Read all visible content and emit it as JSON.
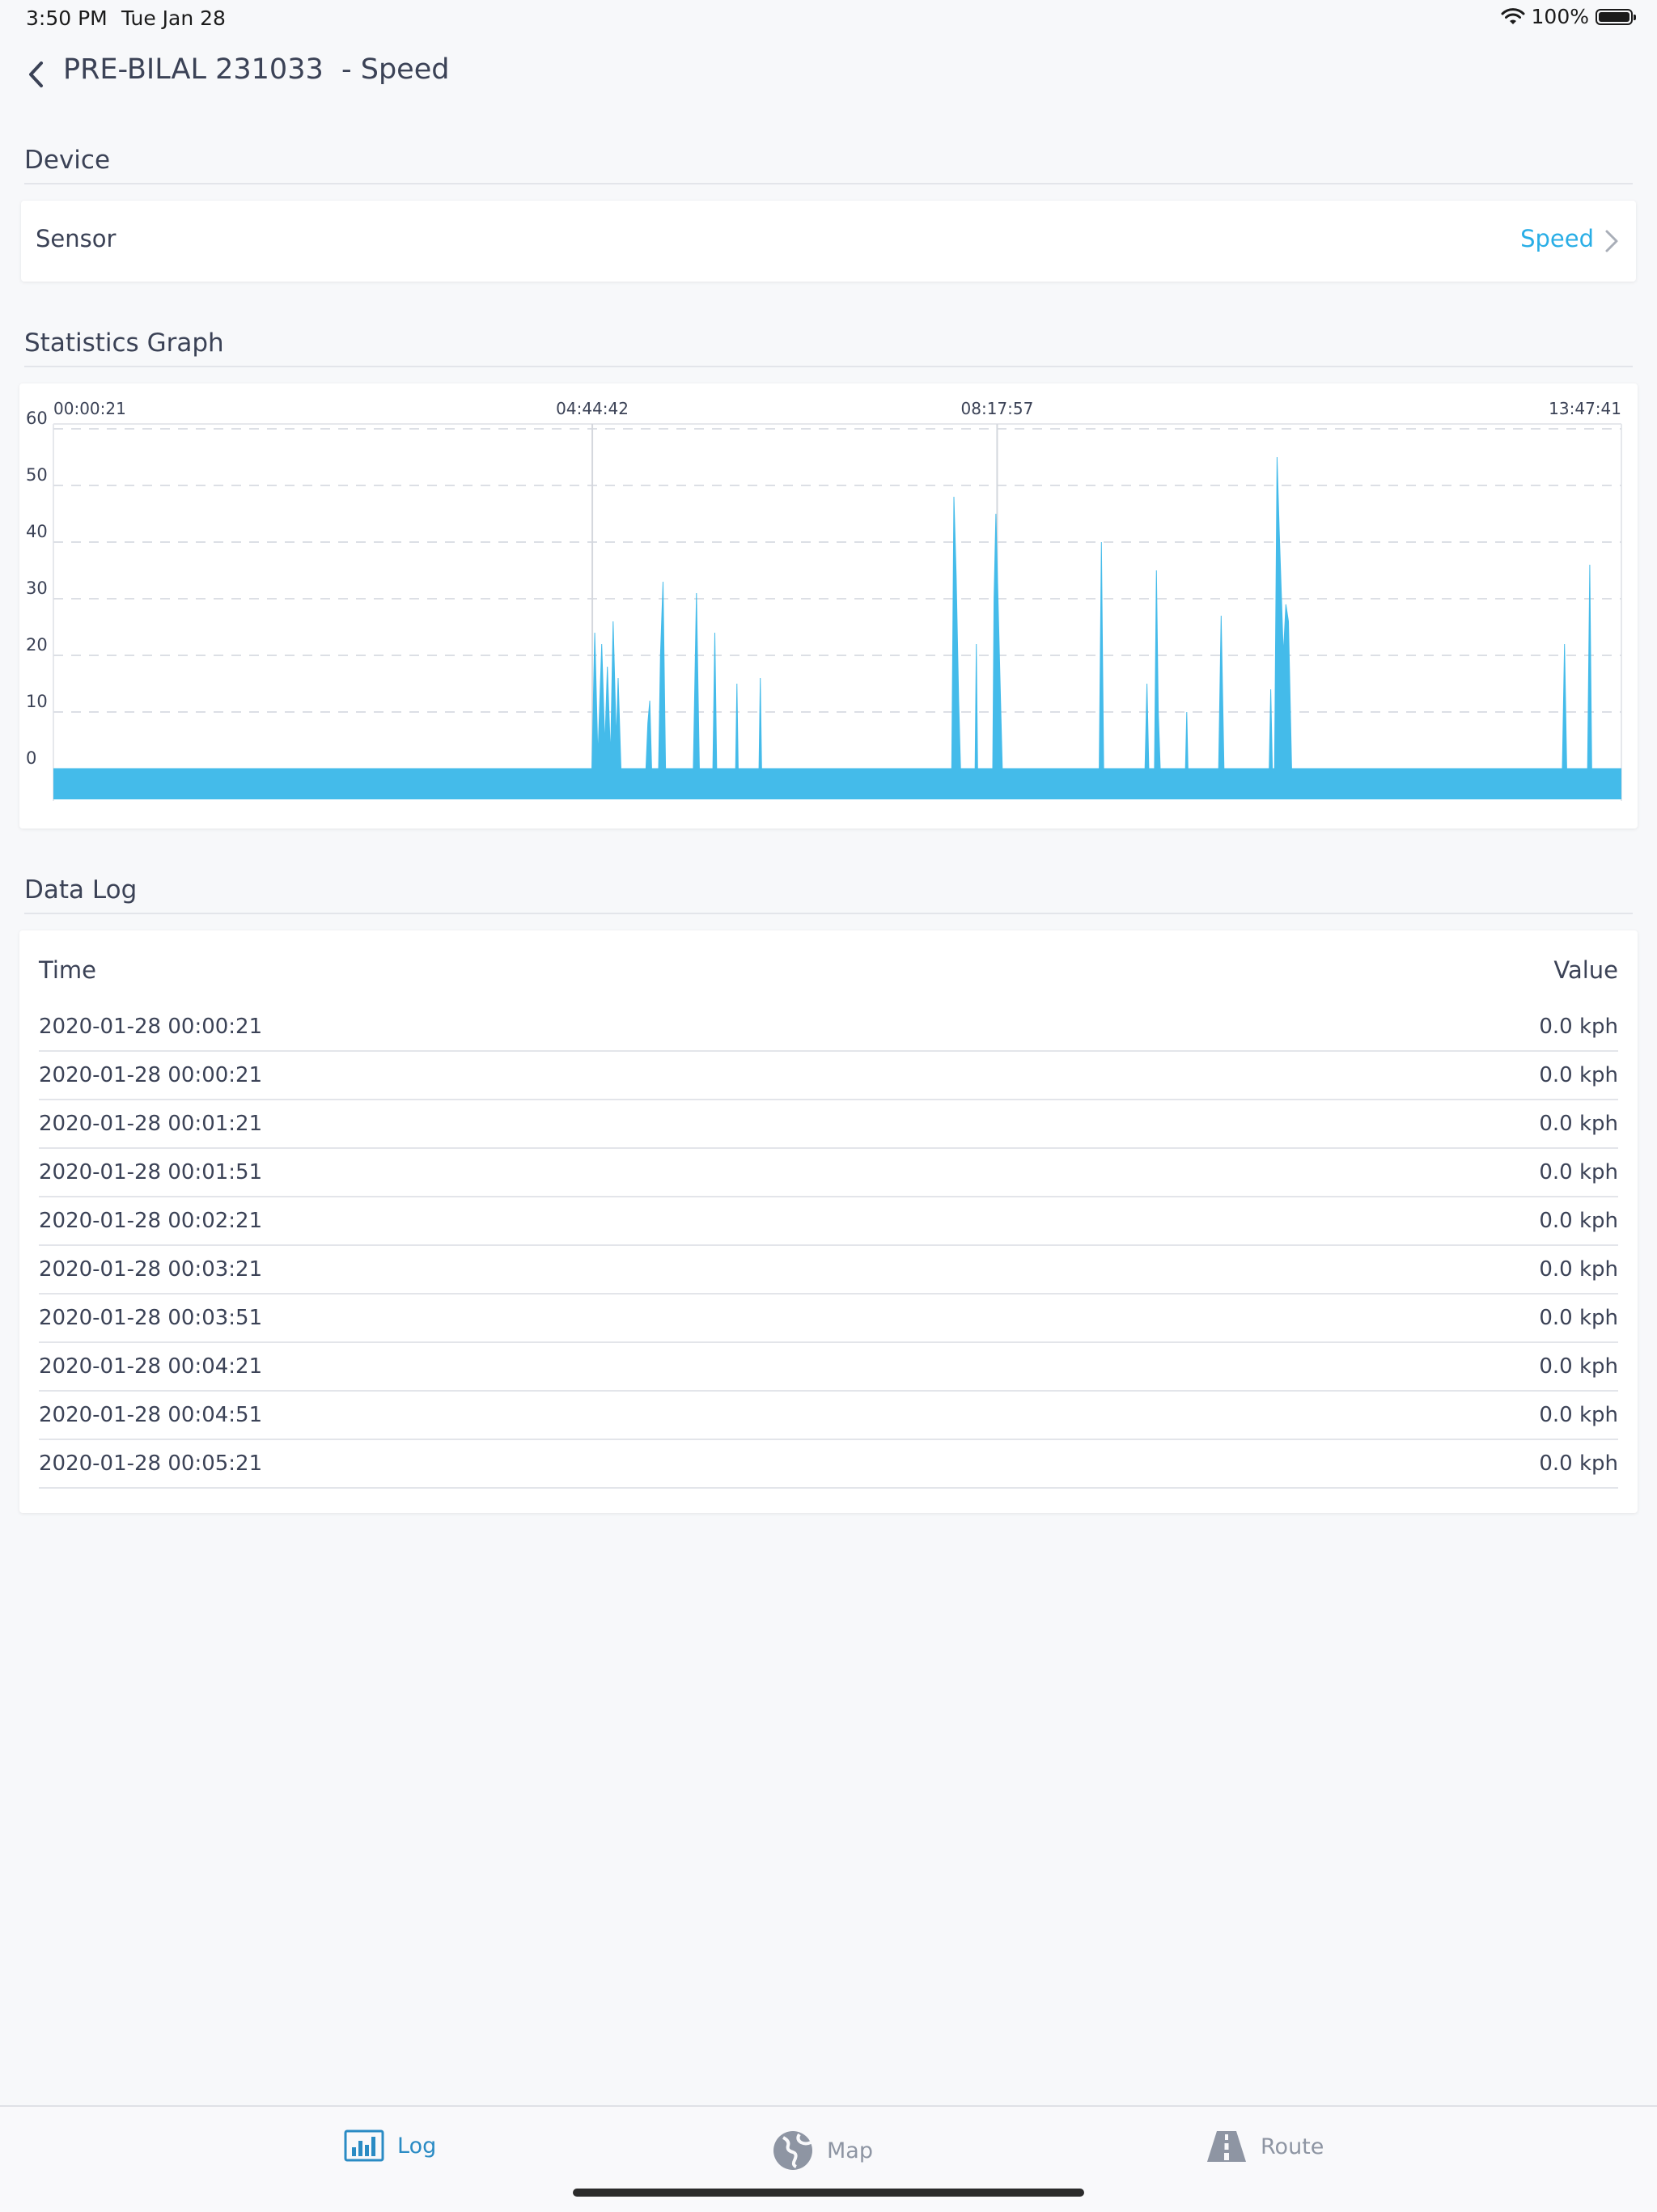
{
  "status_bar": {
    "time": "3:50 PM",
    "date": "Tue Jan 28",
    "battery": "100%",
    "battery_level": 1.0
  },
  "header": {
    "title": "PRE-BILAL 231033  - Speed"
  },
  "device_section": {
    "title": "Device",
    "sensor_label": "Sensor",
    "sensor_value": "Speed"
  },
  "graph_section": {
    "title": "Statistics Graph"
  },
  "chart_data": {
    "type": "area",
    "title": "",
    "xlabel": "",
    "ylabel": "",
    "color": "#44bbea",
    "ylim": [
      0,
      60
    ],
    "yticks": [
      60,
      50,
      40,
      30,
      20,
      10,
      0
    ],
    "top_tick_labels": [
      "00:00:21",
      "04:44:42",
      "08:17:57",
      "13:47:41"
    ],
    "x_range_seconds": [
      21,
      49661
    ],
    "grid": "dashed horizontal",
    "points": [
      [
        21,
        0
      ],
      [
        17070,
        0
      ],
      [
        17160,
        24
      ],
      [
        17260,
        2
      ],
      [
        17380,
        22
      ],
      [
        17480,
        4
      ],
      [
        17560,
        18
      ],
      [
        17660,
        2
      ],
      [
        17740,
        26
      ],
      [
        17840,
        5
      ],
      [
        17900,
        16
      ],
      [
        17990,
        0
      ],
      [
        18780,
        0
      ],
      [
        18840,
        8
      ],
      [
        18900,
        12
      ],
      [
        18960,
        0
      ],
      [
        19180,
        0
      ],
      [
        19240,
        20
      ],
      [
        19320,
        33
      ],
      [
        19400,
        0
      ],
      [
        20280,
        0
      ],
      [
        20380,
        31
      ],
      [
        20470,
        0
      ],
      [
        20900,
        0
      ],
      [
        20960,
        24
      ],
      [
        21020,
        0
      ],
      [
        21620,
        0
      ],
      [
        21660,
        15
      ],
      [
        21700,
        0
      ],
      [
        22360,
        0
      ],
      [
        22400,
        16
      ],
      [
        22440,
        0
      ],
      [
        28460,
        0
      ],
      [
        28530,
        48
      ],
      [
        28600,
        34
      ],
      [
        28680,
        12
      ],
      [
        28740,
        0
      ],
      [
        29200,
        0
      ],
      [
        29240,
        22
      ],
      [
        29280,
        0
      ],
      [
        29760,
        0
      ],
      [
        29800,
        30
      ],
      [
        29860,
        45
      ],
      [
        29960,
        22
      ],
      [
        30060,
        0
      ],
      [
        33130,
        0
      ],
      [
        33200,
        40
      ],
      [
        33270,
        0
      ],
      [
        34580,
        0
      ],
      [
        34640,
        15
      ],
      [
        34700,
        0
      ],
      [
        34880,
        0
      ],
      [
        34940,
        35
      ],
      [
        35000,
        10
      ],
      [
        35060,
        0
      ],
      [
        35860,
        0
      ],
      [
        35900,
        10
      ],
      [
        35940,
        0
      ],
      [
        36910,
        0
      ],
      [
        36990,
        27
      ],
      [
        37080,
        0
      ],
      [
        38510,
        0
      ],
      [
        38560,
        14
      ],
      [
        38610,
        0
      ],
      [
        38680,
        0
      ],
      [
        38760,
        55
      ],
      [
        38830,
        42
      ],
      [
        38900,
        30
      ],
      [
        38960,
        20
      ],
      [
        39040,
        29
      ],
      [
        39120,
        26
      ],
      [
        39220,
        0
      ],
      [
        47790,
        0
      ],
      [
        47860,
        22
      ],
      [
        47930,
        0
      ],
      [
        48590,
        0
      ],
      [
        48660,
        36
      ],
      [
        48720,
        0
      ],
      [
        49661,
        0
      ]
    ]
  },
  "data_log": {
    "title": "Data Log",
    "headers": {
      "time": "Time",
      "value": "Value"
    },
    "rows": [
      {
        "time": "2020-01-28 00:00:21",
        "value": "0.0 kph"
      },
      {
        "time": "2020-01-28 00:00:21",
        "value": "0.0 kph"
      },
      {
        "time": "2020-01-28 00:01:21",
        "value": "0.0 kph"
      },
      {
        "time": "2020-01-28 00:01:51",
        "value": "0.0 kph"
      },
      {
        "time": "2020-01-28 00:02:21",
        "value": "0.0 kph"
      },
      {
        "time": "2020-01-28 00:03:21",
        "value": "0.0 kph"
      },
      {
        "time": "2020-01-28 00:03:51",
        "value": "0.0 kph"
      },
      {
        "time": "2020-01-28 00:04:21",
        "value": "0.0 kph"
      },
      {
        "time": "2020-01-28 00:04:51",
        "value": "0.0 kph"
      },
      {
        "time": "2020-01-28 00:05:21",
        "value": "0.0 kph"
      }
    ]
  },
  "tab_bar": {
    "tabs": [
      {
        "label": "Log",
        "icon": "bar-chart-icon",
        "active": true
      },
      {
        "label": "Map",
        "icon": "globe-icon",
        "active": false
      },
      {
        "label": "Route",
        "icon": "road-icon",
        "active": false
      }
    ],
    "active_color": "#2a8bc4",
    "inactive_color": "#8e95a3"
  }
}
